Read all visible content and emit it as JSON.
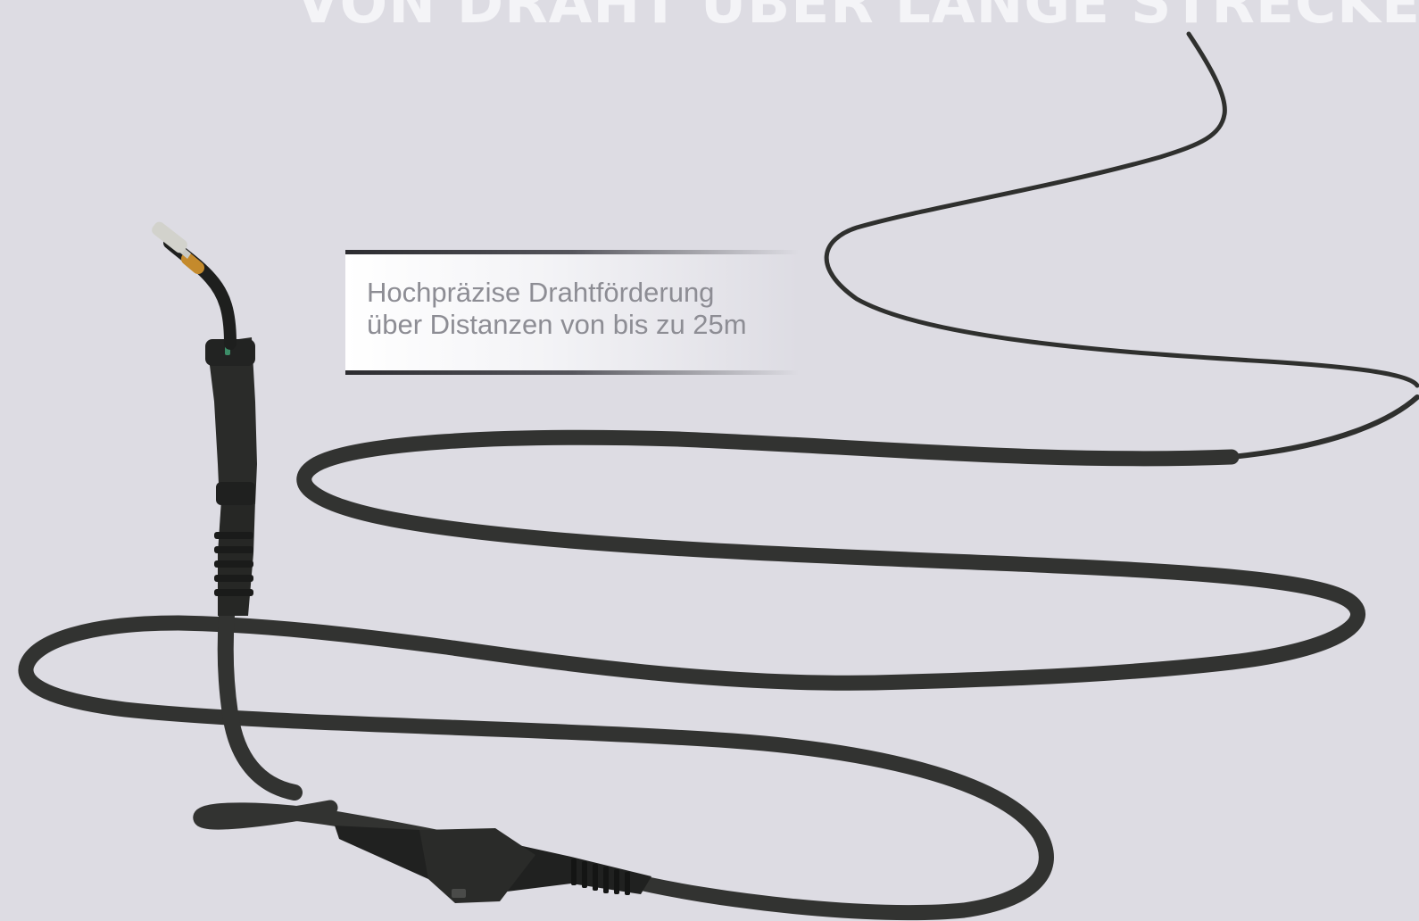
{
  "headline": "VON DRAHT ÜBER LANGE STRECKEN",
  "callout": {
    "line1": "Hochpräzise Drahtförderung",
    "line2": "über Distanzen von bis zu 25m"
  },
  "image": {
    "subject_icon": "welding-torch-hose-icon"
  },
  "colors": {
    "background": "#dddce3",
    "headline": "#f4f4f7",
    "hose": "#2f302e",
    "callout_text": "#8d8d94"
  }
}
